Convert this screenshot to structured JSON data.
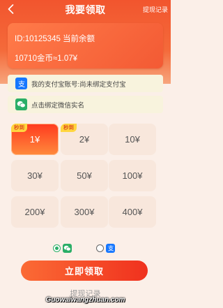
{
  "nav": {
    "title": "我要领取",
    "records_label": "提现记录"
  },
  "balance": {
    "id_line": "ID:10125345 当前余额",
    "coins_line": "10710金币≈1.07¥"
  },
  "bindings": {
    "alipay_text": "我的支付宝账号:尚未绑定支付宝",
    "wechat_text": "点击绑定微信实名"
  },
  "amounts": [
    {
      "label": "1¥",
      "tag": "秒到",
      "selected": true
    },
    {
      "label": "2¥",
      "tag": "秒到",
      "selected": false
    },
    {
      "label": "10¥"
    },
    {
      "label": "30¥"
    },
    {
      "label": "50¥"
    },
    {
      "label": "100¥"
    },
    {
      "label": "200¥"
    },
    {
      "label": "300¥"
    },
    {
      "label": "400¥"
    }
  ],
  "payment": {
    "selected": "wechat"
  },
  "submit_label": "立即领取",
  "bottom_link": "提现记录",
  "watermark": "Guowaiwangzhuan.com",
  "colors": {
    "brand_orange": "#f2552e",
    "wechat_green": "#2aae67",
    "alipay_blue": "#1677ff"
  }
}
